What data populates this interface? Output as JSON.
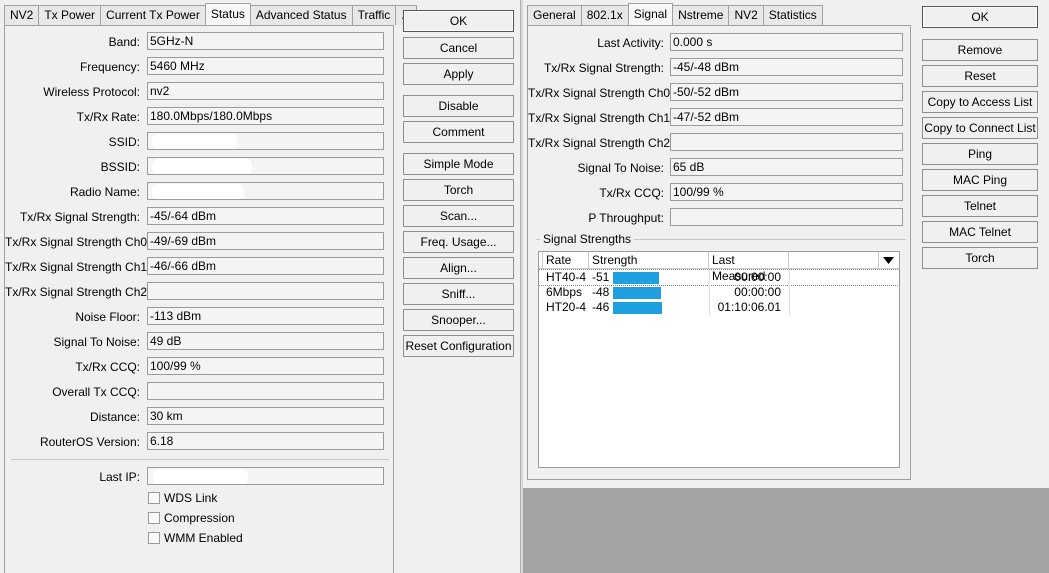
{
  "left": {
    "tabs": [
      "NV2",
      "Tx Power",
      "Current Tx Power",
      "Status",
      "Advanced Status",
      "Traffic",
      "..."
    ],
    "active_tab": "Status",
    "rows": [
      {
        "label": "Band:",
        "value": "5GHz-N"
      },
      {
        "label": "Frequency:",
        "value": "5460 MHz"
      },
      {
        "label": "Wireless Protocol:",
        "value": "nv2"
      },
      {
        "label": "Tx/Rx Rate:",
        "value": "180.0Mbps/180.0Mbps"
      },
      {
        "label": "SSID:",
        "value": ""
      },
      {
        "label": "BSSID:",
        "value": ""
      },
      {
        "label": "Radio Name:",
        "value": ""
      },
      {
        "label": "Tx/Rx Signal Strength:",
        "value": "-45/-64 dBm"
      },
      {
        "label": "Tx/Rx Signal Strength Ch0:",
        "value": "-49/-69 dBm"
      },
      {
        "label": "Tx/Rx Signal Strength Ch1:",
        "value": "-46/-66 dBm"
      },
      {
        "label": "Tx/Rx Signal Strength Ch2:",
        "value": ""
      },
      {
        "label": "Noise Floor:",
        "value": "-113 dBm"
      },
      {
        "label": "Signal To Noise:",
        "value": "49 dB"
      },
      {
        "label": "Tx/Rx CCQ:",
        "value": "100/99 %"
      },
      {
        "label": "Overall Tx CCQ:",
        "value": ""
      },
      {
        "label": "Distance:",
        "value": "30 km"
      },
      {
        "label": "RouterOS Version:",
        "value": "6.18"
      }
    ],
    "last_ip_label": "Last IP:",
    "last_ip_value": "",
    "checkboxes": [
      "WDS Link",
      "Compression",
      "WMM Enabled"
    ]
  },
  "left_buttons": [
    "OK",
    "Cancel",
    "Apply",
    "Disable",
    "Comment",
    "Simple Mode",
    "Torch",
    "Scan...",
    "Freq. Usage...",
    "Align...",
    "Sniff...",
    "Snooper...",
    "Reset Configuration"
  ],
  "right": {
    "tabs": [
      "General",
      "802.1x",
      "Signal",
      "Nstreme",
      "NV2",
      "Statistics"
    ],
    "active_tab": "Signal",
    "rows": [
      {
        "label": "Last Activity:",
        "value": "0.000 s"
      },
      {
        "label": "Tx/Rx Signal Strength:",
        "value": "-45/-48 dBm"
      },
      {
        "label": "Tx/Rx Signal Strength Ch0:",
        "value": "-50/-52 dBm"
      },
      {
        "label": "Tx/Rx Signal Strength Ch1:",
        "value": "-47/-52 dBm"
      },
      {
        "label": "Tx/Rx Signal Strength Ch2:",
        "value": ""
      },
      {
        "label": "Signal To Noise:",
        "value": "65 dB"
      },
      {
        "label": "Tx/Rx CCQ:",
        "value": "100/99 %"
      },
      {
        "label": "P Throughput:",
        "value": ""
      }
    ],
    "group_title": "Signal Strengths",
    "table": {
      "columns": [
        "Rate",
        "Strength",
        "Last Measured"
      ],
      "rows": [
        {
          "rate": "HT40-4",
          "strength": "-51",
          "bar_fraction": 0.92,
          "last": "00:00:00"
        },
        {
          "rate": "6Mbps",
          "strength": "-48",
          "bar_fraction": 0.95,
          "last": "00:00:00"
        },
        {
          "rate": "HT20-4",
          "strength": "-46",
          "bar_fraction": 0.97,
          "last": "01:10:06.01"
        }
      ]
    }
  },
  "right_buttons": [
    "OK",
    "Remove",
    "Reset",
    "Copy to Access List",
    "Copy to Connect List",
    "Ping",
    "MAC Ping",
    "Telnet",
    "MAC Telnet",
    "Torch"
  ],
  "colors": {
    "bar": "#1e9fe0"
  }
}
